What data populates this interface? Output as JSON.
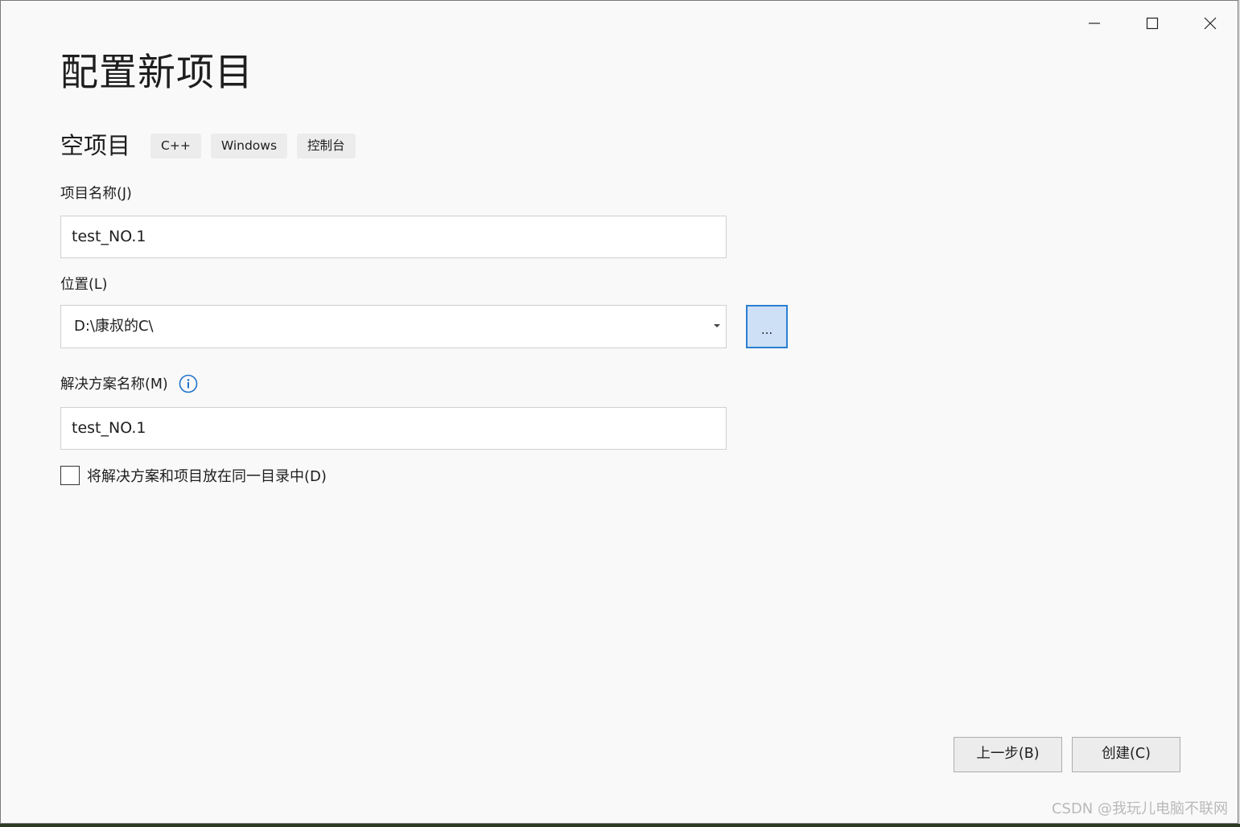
{
  "window": {
    "controls": {
      "minimize_icon": "minimize-icon",
      "maximize_icon": "maximize-icon",
      "close_icon": "close-icon"
    }
  },
  "page": {
    "title": "配置新项目",
    "template_name": "空项目",
    "tags": [
      "C++",
      "Windows",
      "控制台"
    ]
  },
  "form": {
    "project_name": {
      "label": "项目名称(J)",
      "value": "test_NO.1"
    },
    "location": {
      "label": "位置(L)",
      "value": "D:\\康叔的C\\",
      "browse_label": "..."
    },
    "solution_name": {
      "label": "解决方案名称(M)",
      "value": "test_NO.1",
      "info_icon": "info-icon"
    },
    "same_dir_checkbox": {
      "label": "将解决方案和项目放在同一目录中(D)",
      "checked": false
    }
  },
  "footer": {
    "back_label": "上一步(B)",
    "create_label": "创建(C)"
  },
  "watermark": "CSDN @我玩儿电脑不联网",
  "colors": {
    "background": "#f9f9f9",
    "accent": "#2a7fd1",
    "browse_fill": "#cde0f6"
  }
}
